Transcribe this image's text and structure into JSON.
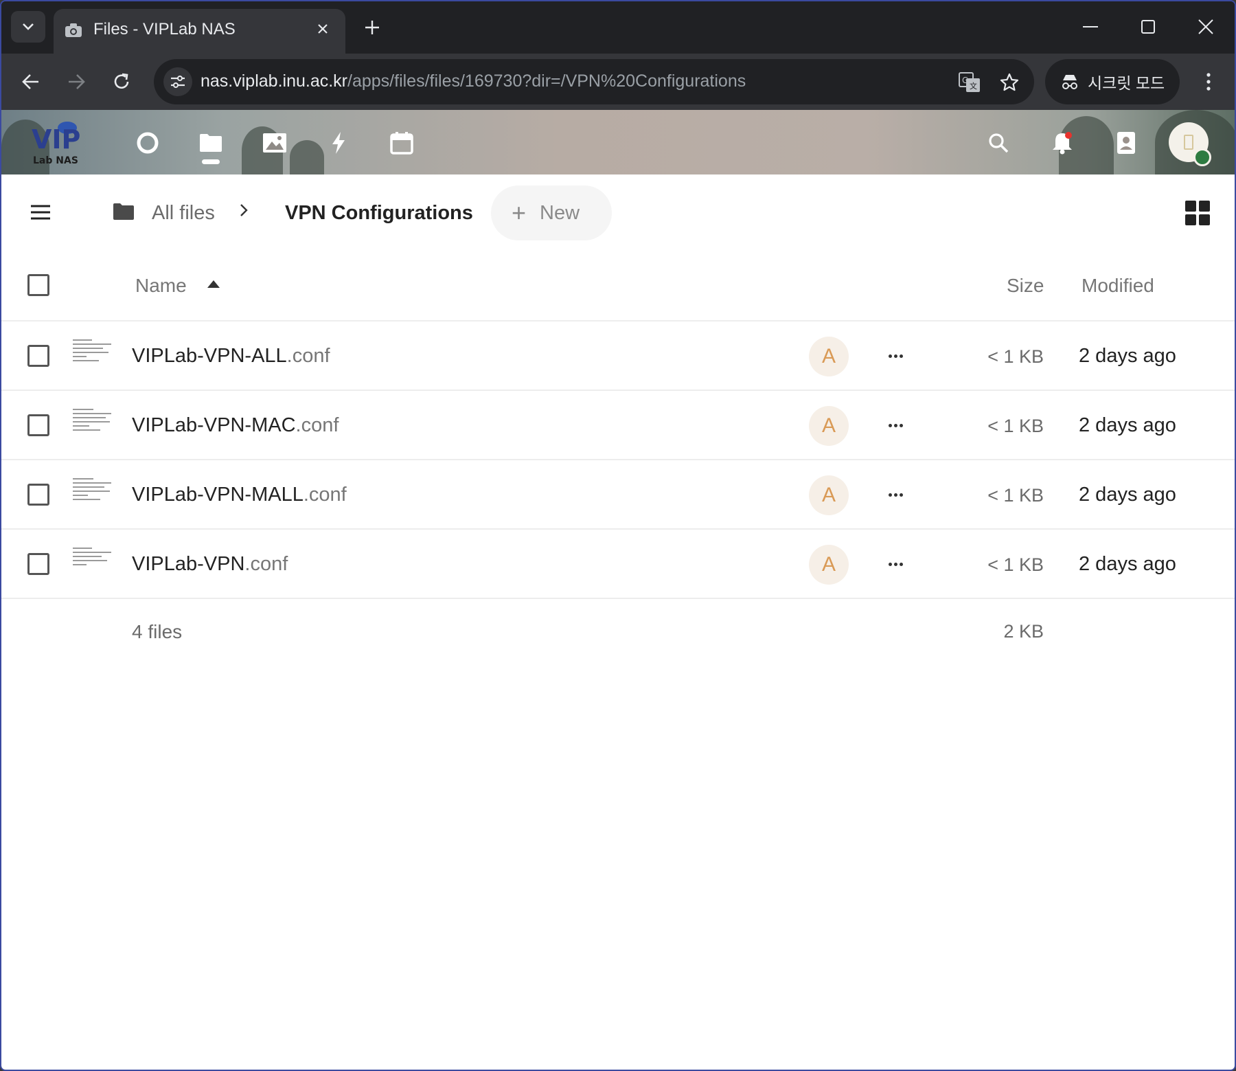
{
  "browser": {
    "tab_title": "Files - VIPLab NAS",
    "url_host": "nas.viplab.inu.ac.kr",
    "url_path": "/apps/files/files/169730?dir=/VPN%20Configurations",
    "incognito_label": "시크릿 모드",
    "icons": [
      "tab-search-icon",
      "camera-favicon-icon",
      "close-icon",
      "plus-icon",
      "minimize-icon",
      "maximize-icon",
      "close-window-icon",
      "back-icon",
      "forward-icon",
      "reload-icon",
      "site-info-icon",
      "translate-icon",
      "star-icon",
      "incognito-icon",
      "kebab-menu-icon"
    ]
  },
  "header": {
    "logo_text_top": "VIP",
    "logo_text_bottom": "Lab NAS",
    "apps": [
      "dashboard-icon",
      "files-icon",
      "photos-icon",
      "activity-icon",
      "calendar-icon"
    ],
    "active_app": "files",
    "right_icons": [
      "search-icon",
      "notifications-icon",
      "contacts-icon"
    ],
    "notification_dot_color": "#e9322d",
    "user_status_color": "#2d7b41"
  },
  "breadcrumb": {
    "root": "All files",
    "separator": ">",
    "current": "VPN Configurations"
  },
  "new_button": {
    "label": "New"
  },
  "table": {
    "columns": {
      "name": "Name",
      "size": "Size",
      "modified": "Modified"
    },
    "sort": "name-ascending",
    "rows": [
      {
        "base": "VIPLab-VPN-ALL",
        "ext": ".conf",
        "share": "A",
        "size": "< 1 KB",
        "modified": "2 days ago"
      },
      {
        "base": "VIPLab-VPN-MAC",
        "ext": ".conf",
        "share": "A",
        "size": "< 1 KB",
        "modified": "2 days ago"
      },
      {
        "base": "VIPLab-VPN-MALL",
        "ext": ".conf",
        "share": "A",
        "size": "< 1 KB",
        "modified": "2 days ago"
      },
      {
        "base": "VIPLab-VPN",
        "ext": ".conf",
        "share": "A",
        "size": "< 1 KB",
        "modified": "2 days ago"
      }
    ],
    "summary": {
      "count": "4 files",
      "total_size": "2 KB"
    }
  },
  "colors": {
    "accent": "#1f2124",
    "share_avatar_bg": "#f6efe7",
    "share_avatar_fg": "#d99a56"
  }
}
